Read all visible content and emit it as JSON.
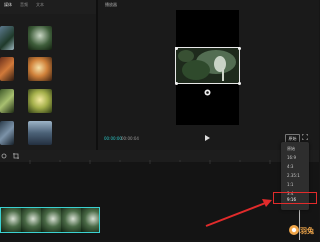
{
  "left_panel": {
    "tabs": [
      "媒体",
      "音频",
      "文本"
    ]
  },
  "player": {
    "title": "播放器",
    "current_time": "00:00:00",
    "total_time": "00:00:04",
    "ratio_label": "原始"
  },
  "ratio_menu": {
    "items": [
      "原始",
      "16:9",
      "4:3",
      "2.35:1",
      "1:1",
      "3:4",
      "9:16"
    ],
    "highlighted": "9:16"
  },
  "colors": {
    "accent": "#2bc5c5",
    "highlight": "#e12b2b"
  },
  "watermark": {
    "text": "羽兔"
  }
}
